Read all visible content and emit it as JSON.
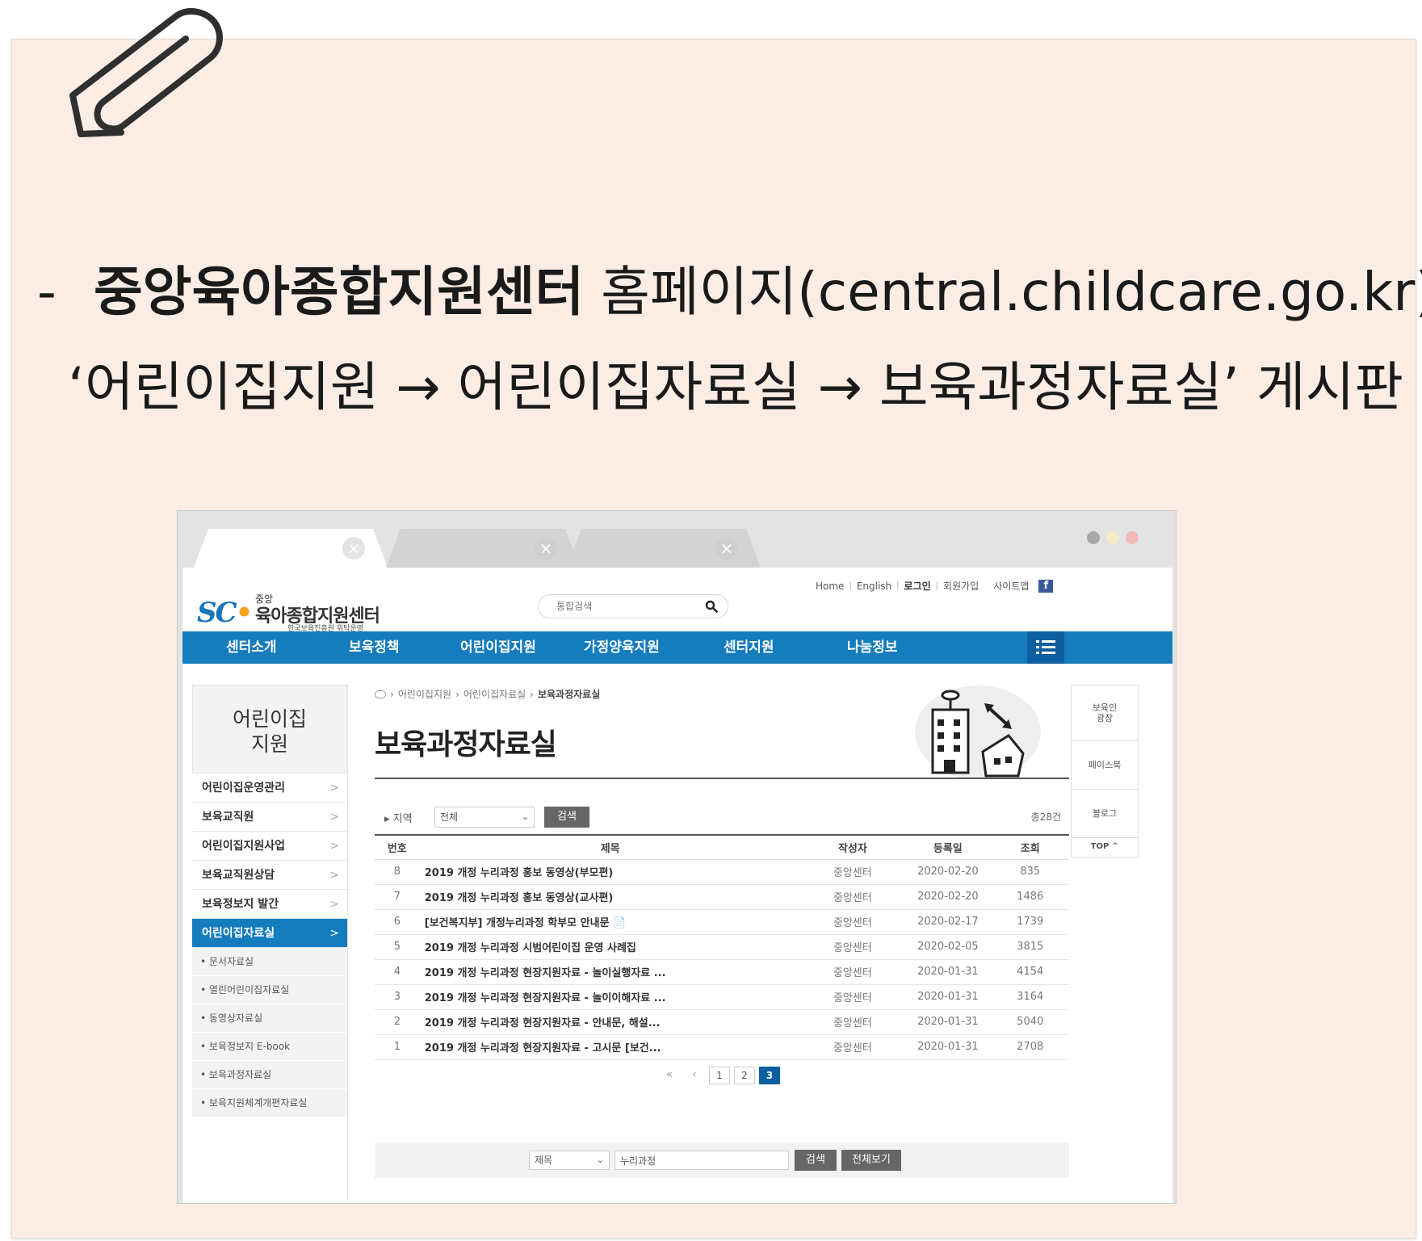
{
  "heading": {
    "line1_bold": "중앙육아종합지원센터",
    "line1_rest": " 홈페이지(central.childcare.go.kr)",
    "line2": "‘어린이집지원 → 어린이집자료실 → 보육과정자료실’ 게시판",
    "dash": "-"
  },
  "browser": {
    "tab_close_glyph": "×",
    "window_dot_colors": [
      "#a8a8a8",
      "#f3ecc4",
      "#f3b7b7"
    ]
  },
  "site": {
    "logo": {
      "mark": "SC",
      "small": "중앙",
      "main": "육아종합지원센터",
      "sub": "한국보육진흥원 위탁운영"
    },
    "search": {
      "placeholder": "통합검색"
    },
    "util_links": {
      "home": "Home",
      "english": "English",
      "login": "로그인",
      "join": "회원가입",
      "sitemap": "사이트맵",
      "facebook": "f"
    },
    "gnb": [
      "센터소개",
      "보육정책",
      "어린이집지원",
      "가정양육지원",
      "센터지원",
      "나눔정보"
    ],
    "lnb": {
      "title_line1": "어린이집",
      "title_line2": "지원",
      "items": [
        "어린이집운영관리",
        "보육교직원",
        "어린이집지원사업",
        "보육교직원상담",
        "보육정보지 발간",
        "어린이집자료실"
      ],
      "active_index": 5,
      "sub_items": [
        "• 문서자료실",
        "• 열린어린이집자료실",
        "• 동영상자료실",
        "• 보육정보지 E-book",
        "• 보육과정자료실",
        "• 보육지원체계개편자료실"
      ],
      "chevron": ">"
    },
    "breadcrumb": {
      "sep": "›",
      "items": [
        "어린이집지원",
        "어린이집자료실",
        "보육과정자료실"
      ]
    },
    "page_title": "보육과정자료실",
    "filter": {
      "label": "▸ 지역",
      "select_value": "전체",
      "button": "검색",
      "total": "총28건"
    },
    "board": {
      "headers": [
        "번호",
        "제목",
        "작성자",
        "등록일",
        "조회"
      ],
      "rows": [
        {
          "no": "8",
          "subject": "2019 개정 누리과정 홍보 동영상(부모편)",
          "writer": "중앙센터",
          "date": "2020-02-20",
          "views": "835"
        },
        {
          "no": "7",
          "subject": "2019 개정 누리과정 홍보 동영상(교사편)",
          "writer": "중앙센터",
          "date": "2020-02-20",
          "views": "1486"
        },
        {
          "no": "6",
          "subject": "[보건복지부] 개정누리과정 학부모 안내문 📄",
          "writer": "중앙센터",
          "date": "2020-02-17",
          "views": "1739"
        },
        {
          "no": "5",
          "subject": "2019 개정 누리과정 시범어린이집 운영 사례집",
          "writer": "중앙센터",
          "date": "2020-02-05",
          "views": "3815"
        },
        {
          "no": "4",
          "subject": "2019 개정 누리과정 현장지원자료 - 놀이실행자료 ...",
          "writer": "중앙센터",
          "date": "2020-01-31",
          "views": "4154"
        },
        {
          "no": "3",
          "subject": "2019 개정 누리과정 현장지원자료 - 놀이이해자료 ...",
          "writer": "중앙센터",
          "date": "2020-01-31",
          "views": "3164"
        },
        {
          "no": "2",
          "subject": "2019 개정 누리과정 현장지원자료 - 안내문, 해설...",
          "writer": "중앙센터",
          "date": "2020-01-31",
          "views": "5040"
        },
        {
          "no": "1",
          "subject": "2019 개정 누리과정 현장지원자료 - 고시문 [보건...",
          "writer": "중앙센터",
          "date": "2020-01-31",
          "views": "2708"
        }
      ]
    },
    "pagination": {
      "first": "«",
      "prev": "‹",
      "pages": [
        "1",
        "2",
        "3"
      ],
      "current": "3"
    },
    "bottom_search": {
      "select_value": "제목",
      "input_value": "누리과정",
      "search_button": "검색",
      "view_all_button": "전체보기"
    },
    "quick_menu": {
      "items": [
        "보육인\n광장",
        "페이스북",
        "블로그"
      ],
      "top": "TOP ⌃"
    },
    "colors": {
      "brand_blue": "#157cbd",
      "dark_blue": "#0c5fa0",
      "slide_bg": "#fbede3"
    }
  }
}
